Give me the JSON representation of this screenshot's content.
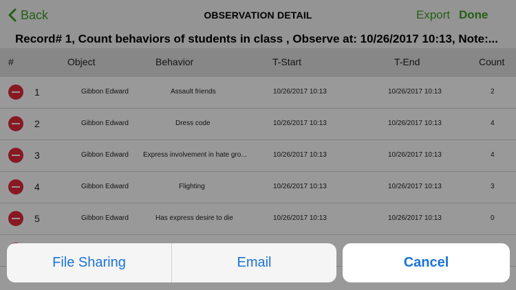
{
  "nav": {
    "back_label": "Back",
    "title": "OBSERVATION DETAIL",
    "export_label": "Export",
    "done_label": "Done"
  },
  "record_line": "Record# 1, Count behaviors of students in class , Observe at: 10/26/2017 10:13, Note:...",
  "columns": {
    "num": "#",
    "object": "Object",
    "behavior": "Behavior",
    "tstart": "T-Start",
    "tend": "T-End",
    "count": "Count"
  },
  "rows": [
    {
      "num": "1",
      "object": "Gibbon Edward",
      "behavior": "Assault friends",
      "tstart": "10/26/2017 10:13",
      "tend": "10/26/2017 10:13",
      "count": "2"
    },
    {
      "num": "2",
      "object": "Gibbon Edward",
      "behavior": "Dress code",
      "tstart": "10/26/2017 10:13",
      "tend": "10/26/2017 10:13",
      "count": "4"
    },
    {
      "num": "3",
      "object": "Gibbon Edward",
      "behavior": "Express involvement in hate gro...",
      "tstart": "10/26/2017 10:13",
      "tend": "10/26/2017 10:13",
      "count": "4"
    },
    {
      "num": "4",
      "object": "Gibbon Edward",
      "behavior": "Flighting",
      "tstart": "10/26/2017 10:13",
      "tend": "10/26/2017 10:13",
      "count": "3"
    },
    {
      "num": "5",
      "object": "Gibbon Edward",
      "behavior": "Has express desire to die",
      "tstart": "10/26/2017 10:13",
      "tend": "10/26/2017 10:13",
      "count": "0"
    }
  ],
  "action_sheet": {
    "file_sharing_label": "File Sharing",
    "email_label": "Email",
    "cancel_label": "Cancel"
  },
  "colors": {
    "accent_green": "#3c9d24",
    "action_blue": "#1a73d6",
    "delete_red": "#e3283a"
  }
}
